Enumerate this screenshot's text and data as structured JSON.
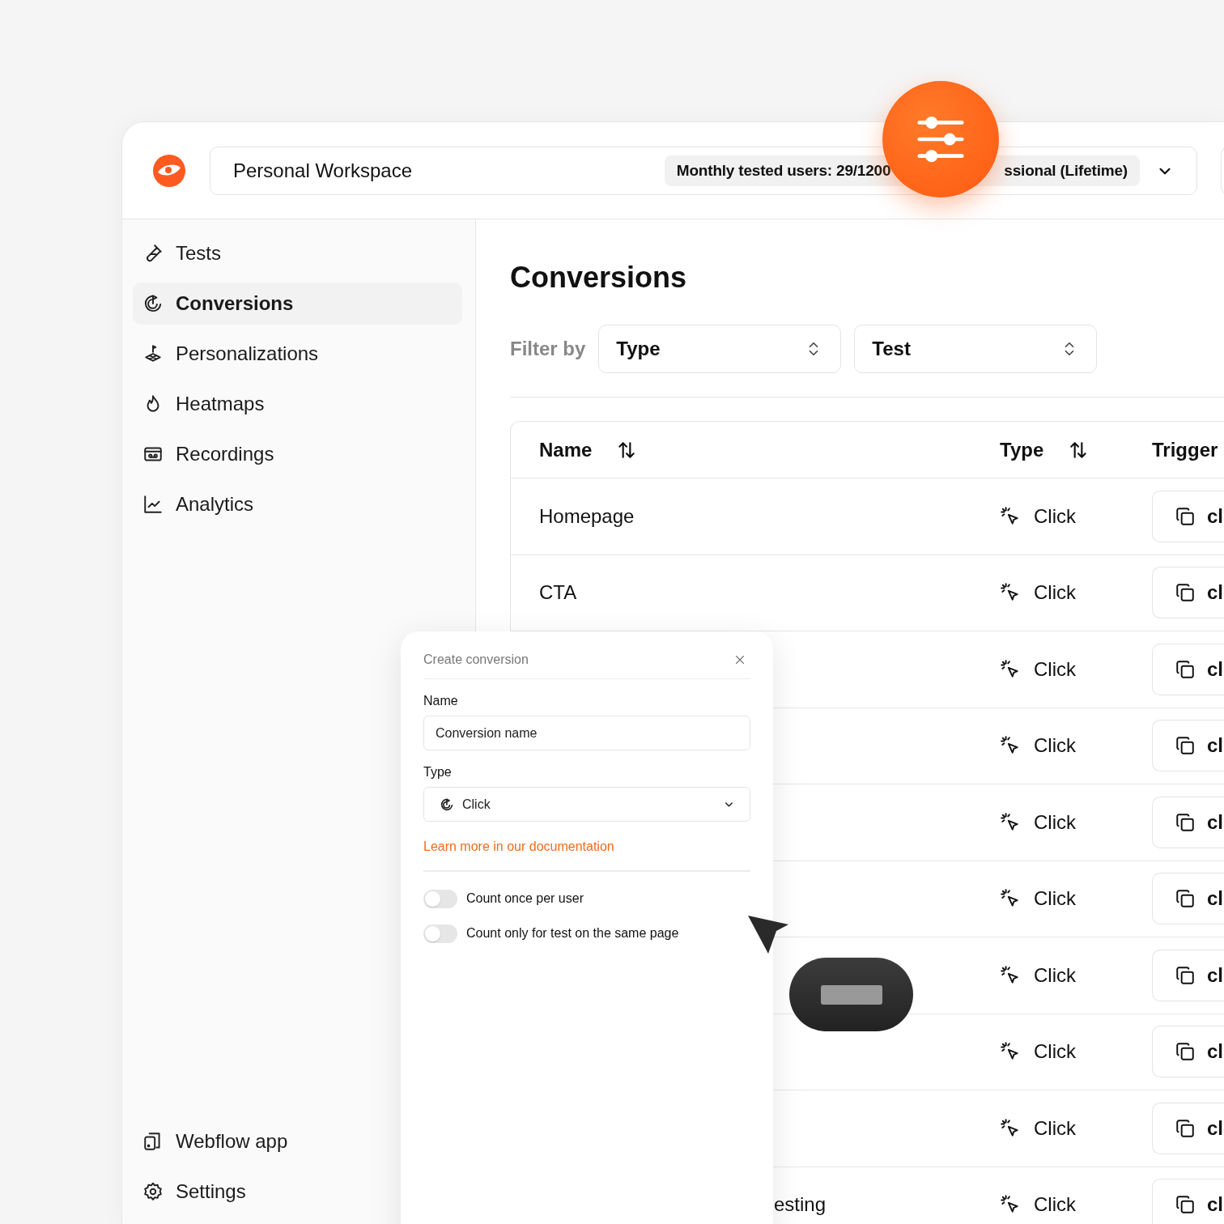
{
  "header": {
    "workspace": "Personal Workspace",
    "usage": "Monthly tested users: 29/1200",
    "plan": "ssional (Lifetime)"
  },
  "sidebar": {
    "items": [
      {
        "label": "Tests",
        "selected": false
      },
      {
        "label": "Conversions",
        "selected": true
      },
      {
        "label": "Personalizations",
        "selected": false
      },
      {
        "label": "Heatmaps",
        "selected": false
      },
      {
        "label": "Recordings",
        "selected": false
      },
      {
        "label": "Analytics",
        "selected": false
      }
    ],
    "footer_items": [
      {
        "label": "Webflow app"
      },
      {
        "label": "Settings"
      }
    ]
  },
  "main": {
    "title": "Conversions",
    "filter_label": "Filter by",
    "filters": [
      {
        "label": "Type"
      },
      {
        "label": "Test"
      }
    ],
    "table": {
      "columns": [
        {
          "label": "Name",
          "sortable": true
        },
        {
          "label": "Type",
          "sortable": true
        },
        {
          "label": "Trigger"
        }
      ],
      "rows": [
        {
          "name": "Homepage",
          "type": "Click",
          "trigger": "cl"
        },
        {
          "name": "CTA",
          "type": "Click",
          "trigger": "cl"
        },
        {
          "type": "Click",
          "trigger": "cl"
        },
        {
          "type": "Click",
          "trigger": "cl"
        },
        {
          "type": "Click",
          "trigger": "cl"
        },
        {
          "type": "Click",
          "trigger": "cl"
        },
        {
          "type": "Click",
          "trigger": "cl"
        },
        {
          "type": "Click",
          "trigger": "cl"
        },
        {
          "type": "Click",
          "trigger": "cl"
        },
        {
          "name": "esting",
          "partial": true,
          "type": "Click",
          "trigger": "cl"
        }
      ]
    }
  },
  "dialog": {
    "title": "Create conversion",
    "fields": [
      {
        "label": "Name",
        "kind": "text",
        "value": "Conversion name"
      },
      {
        "label": "Type",
        "kind": "select",
        "value": "Click"
      }
    ],
    "link": "Learn more in our documentation",
    "toggles": [
      {
        "label": "Count once per user",
        "on": false
      },
      {
        "label": "Count only for test on the same page",
        "on": false
      }
    ]
  }
}
